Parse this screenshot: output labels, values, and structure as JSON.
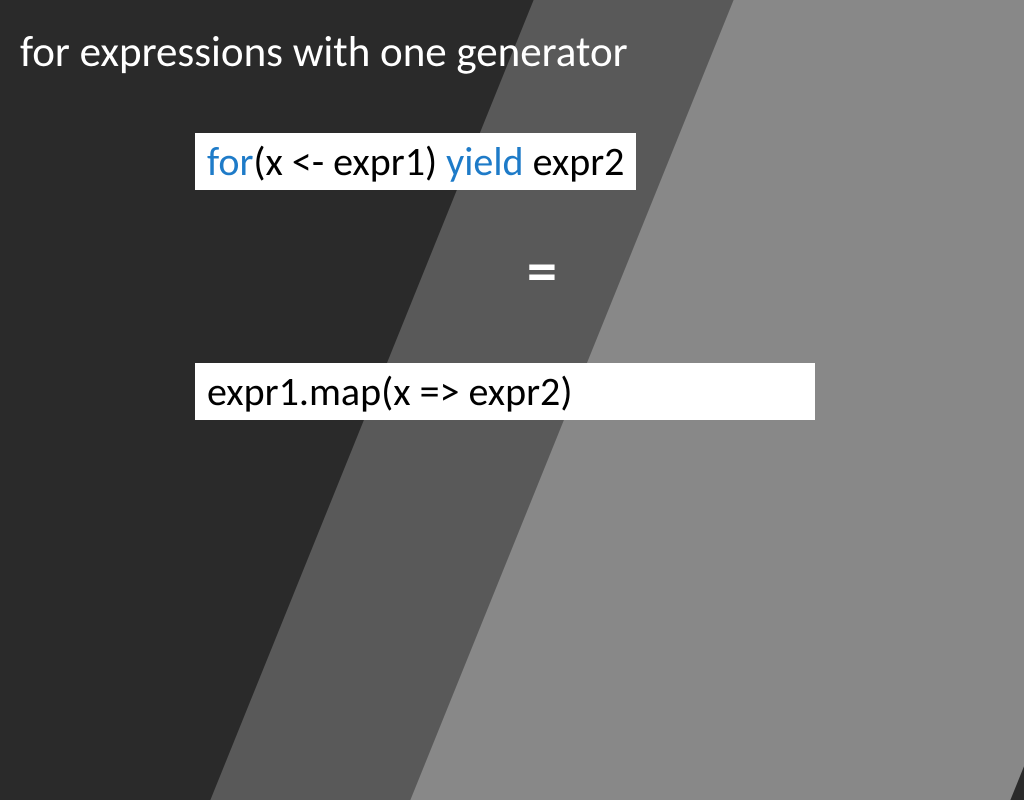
{
  "title": "for expressions with one generator",
  "code1": {
    "kw1": "for",
    "seg1": "(x <- expr1) ",
    "kw2": "yield",
    "seg2": " expr2"
  },
  "equals": "=",
  "code2": "expr1.map(x => expr2)"
}
